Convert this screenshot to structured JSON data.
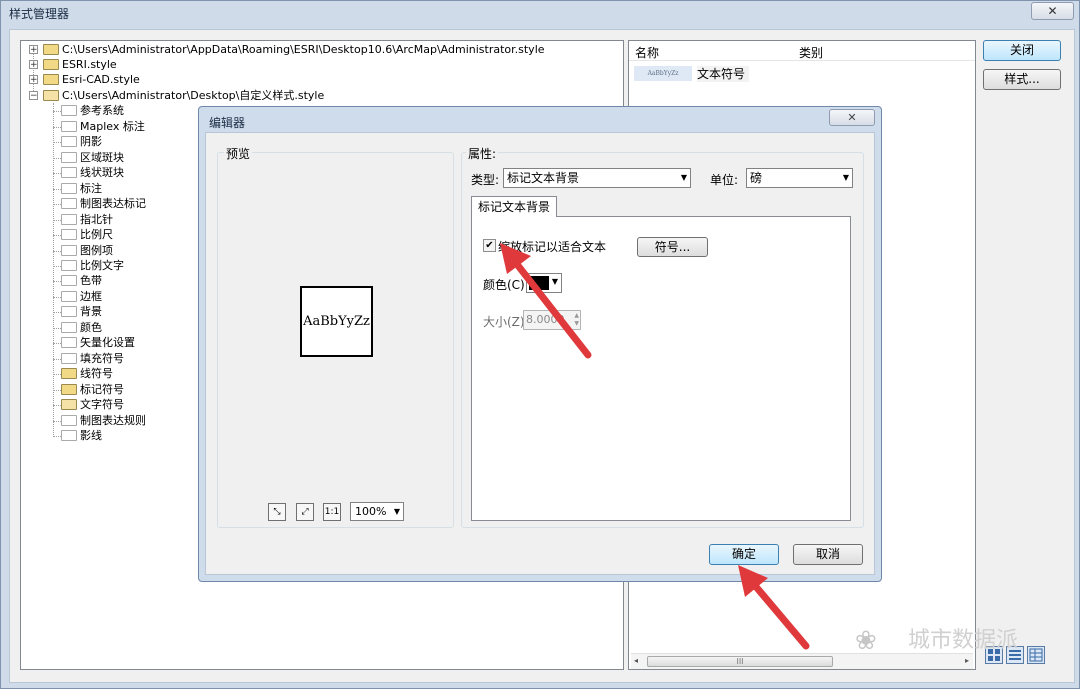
{
  "window": {
    "title": "样式管理器",
    "close_glyph": "✕"
  },
  "tree": {
    "roots": [
      {
        "label": "C:\\Users\\Administrator\\AppData\\Roaming\\ESRI\\Desktop10.6\\ArcMap\\Administrator.style",
        "expander": "+"
      },
      {
        "label": "ESRI.style",
        "expander": "+"
      },
      {
        "label": "Esri-CAD.style",
        "expander": "+"
      },
      {
        "label": "C:\\Users\\Administrator\\Desktop\\自定义样式.style",
        "expander": "−"
      }
    ],
    "children": [
      "参考系统",
      "Maplex 标注",
      "阴影",
      "区域斑块",
      "线状斑块",
      "标注",
      "制图表达标记",
      "指北针",
      "比例尺",
      "图例项",
      "比例文字",
      "色带",
      "边框",
      "背景",
      "颜色",
      "矢量化设置",
      "填充符号",
      "线符号",
      "标记符号",
      "文字符号",
      "制图表达规则",
      "影线"
    ]
  },
  "list": {
    "columns": [
      "名称",
      "类别"
    ],
    "items": [
      {
        "thumb_text": "AaBbYyZz",
        "name": "文本符号"
      }
    ],
    "scroll_grip": "III",
    "scroll_left": "◂",
    "scroll_right": "▸"
  },
  "buttons": {
    "close": "关闭",
    "style": "样式..."
  },
  "watermark": {
    "logo": "❀",
    "text": "城市数据派"
  },
  "editor": {
    "title": "编辑器",
    "close_glyph": "✕",
    "preview": {
      "label": "预览",
      "sample": "AaBbYyZz",
      "zoom": "100%",
      "toolbar_icons": [
        "zoom-in-icon",
        "zoom-out-icon",
        "actual-size-icon"
      ],
      "toolbar_glyphs": [
        "⤡",
        "⤢",
        "1:1"
      ]
    },
    "properties": {
      "label": "属性:",
      "type_label": "类型:",
      "type_value": "标记文本背景",
      "unit_label": "单位:",
      "unit_value": "磅",
      "tab": "标记文本背景",
      "checkbox_label": "缩放标记以适合文本",
      "checkbox_checked": true,
      "check_glyph": "✔",
      "symbol_button": "符号...",
      "color_label": "颜色(C):",
      "color_value": "#000000",
      "size_label": "大小(Z):",
      "size_value": "8.0000"
    },
    "ok": "确定",
    "cancel": "取消"
  },
  "arrow_color": "#e0393c"
}
